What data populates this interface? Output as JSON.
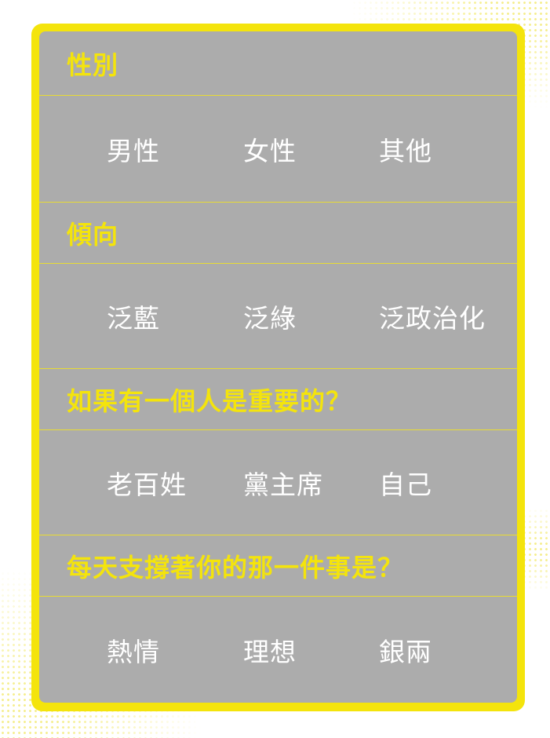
{
  "colors": {
    "accent": "#f4e40c",
    "panel": "#acacac",
    "option_text": "#ffffff"
  },
  "questions": [
    {
      "title": "性別",
      "options": [
        "男性",
        "女性",
        "其他"
      ]
    },
    {
      "title": "傾向",
      "options": [
        "泛藍",
        "泛綠",
        "泛政治化"
      ]
    },
    {
      "title": "如果有一個人是重要的？",
      "options": [
        "老百姓",
        "黨主席",
        "自己"
      ]
    },
    {
      "title": "每天支撐著你的那一件事是？",
      "options": [
        "熱情",
        "理想",
        "銀兩"
      ]
    }
  ]
}
